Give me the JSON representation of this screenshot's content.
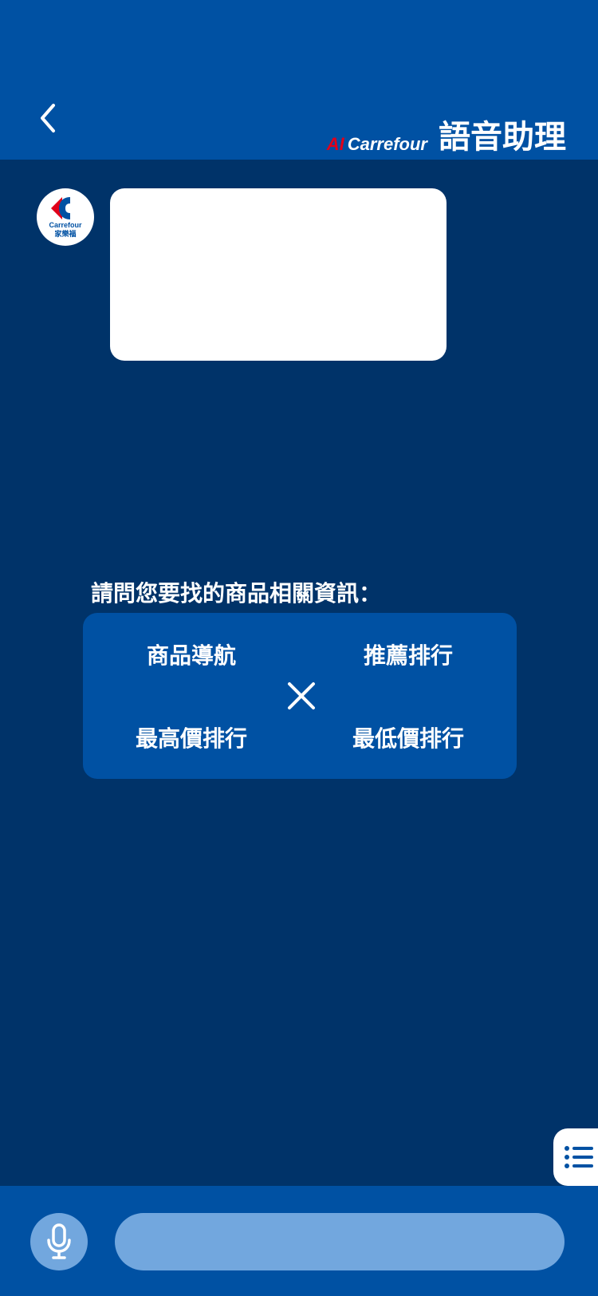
{
  "header": {
    "brand_ai": "AI",
    "brand_name": "Carrefour",
    "title": "語音助理"
  },
  "avatar": {
    "line1": "Carrefour",
    "line2": "家樂福"
  },
  "prompt": "請問您要找的商品相關資訊：",
  "options": {
    "top_left": "商品導航",
    "top_right": "推薦排行",
    "bottom_left": "最高價排行",
    "bottom_right": "最低價排行"
  },
  "input": {
    "placeholder": ""
  },
  "icons": {
    "back": "chevron-left-icon",
    "close": "close-icon",
    "list": "list-icon",
    "mic": "microphone-icon"
  },
  "colors": {
    "header_blue": "#0051a3",
    "page_navy": "#003369",
    "pill_light_blue": "#72a7de",
    "brand_red": "#e1001a"
  }
}
